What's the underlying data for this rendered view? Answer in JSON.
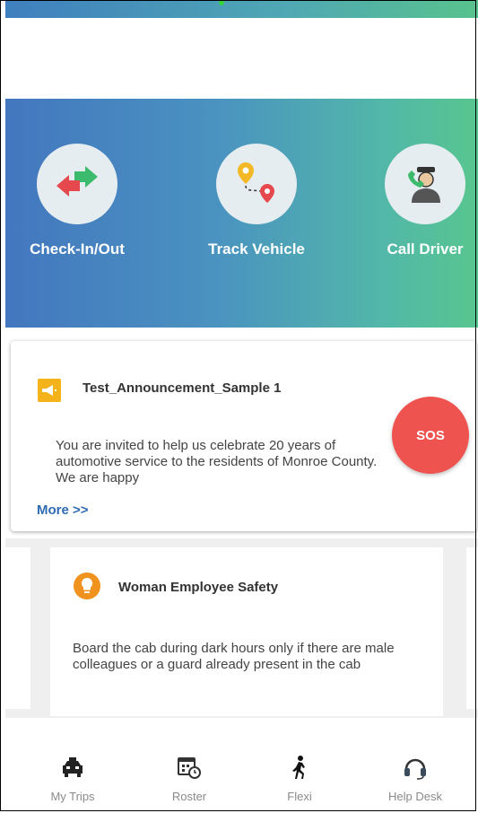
{
  "quick_actions": [
    {
      "label": "Check-In/Out",
      "icon": "check-in-out-icon"
    },
    {
      "label": "Track Vehicle",
      "icon": "track-vehicle-icon"
    },
    {
      "label": "Call Driver",
      "icon": "call-driver-icon"
    }
  ],
  "announcement": {
    "title": "Test_Announcement_Sample 1",
    "body": "You are invited to help us celebrate 20 years of automotive service to the residents of Monroe County. We are happy",
    "more_label": "More >>",
    "icon": "megaphone-icon"
  },
  "sos": {
    "label": "SOS",
    "color": "#ef5350"
  },
  "safety_tip": {
    "title": "Woman Employee Safety",
    "body": "Board the cab during dark hours only if there are male colleagues or a guard already present in the cab",
    "icon": "lightbulb-icon"
  },
  "bottom_nav": [
    {
      "label": "My Trips",
      "icon": "car-icon"
    },
    {
      "label": "Roster",
      "icon": "calendar-clock-icon"
    },
    {
      "label": "Flexi",
      "icon": "walking-person-icon"
    },
    {
      "label": "Help Desk",
      "icon": "headset-icon"
    }
  ],
  "colors": {
    "accent_blue": "#2f6bb2",
    "hero_start": "#4377bf",
    "hero_end": "#58c68f"
  }
}
